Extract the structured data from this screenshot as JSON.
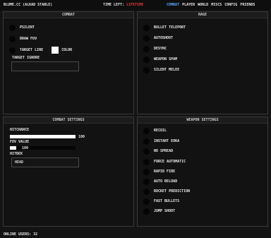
{
  "topbar": {
    "brand": "BLUME.CC (ALKAD STABLE)",
    "time_prefix": "TIME LEFT: ",
    "time_value": "LIFETIME",
    "nav": [
      "COMBAT",
      "PLAYER",
      "WORLD",
      "MISCS",
      "CONFIG",
      "FRIENDS"
    ],
    "active_nav": "COMBAT"
  },
  "combat": {
    "title": "COMBAT",
    "silent": "PSILENT",
    "fov": "DRAW FOV",
    "target_line": "TARGET LINE",
    "color": "COLOR",
    "color_value": "#ffffff",
    "ignore_label": "TARGET IGNORE",
    "ignore_value": ""
  },
  "rage": {
    "title": "RAGE",
    "items": [
      "BULLET TELEPORT",
      "AUTOSHOOT",
      "DESYNC",
      "WEAPON SPAM",
      "SILENT MELEE"
    ]
  },
  "combat_settings": {
    "title": "COMBAT SETTINGS",
    "hitchance_label": "HITCHANCE",
    "hitchance_value": "100",
    "hitchance_fraction": 1.0,
    "fov_label": "FOV VALUE",
    "fov_value": "100",
    "fov_fraction": 0.1,
    "hitbox_label": "HITBOX",
    "hitbox_value": "HEAD"
  },
  "weapon_settings": {
    "title": "WEAPON SETTINGS",
    "items": [
      "RECOIL",
      "INSTANT EOKA",
      "NO SPREAD",
      "FORCE AUTOMATIC",
      "RAPID FIRE",
      "AUTO RELOAD",
      "ROCKET PREDICTION",
      "FAST BULLETS",
      "JUMP SHOOT"
    ]
  },
  "footer": {
    "online": "ONLINE USERS: 32"
  }
}
